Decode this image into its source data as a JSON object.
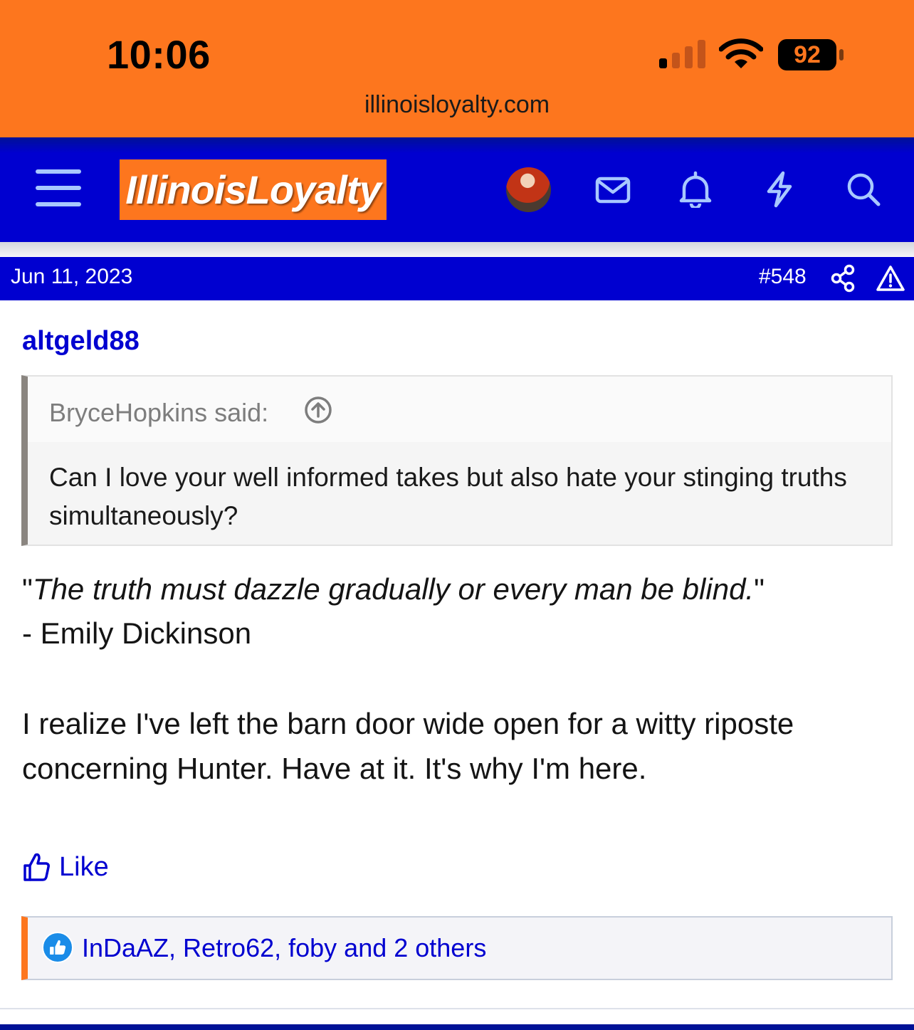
{
  "status_bar": {
    "time": "10:06",
    "battery": "92",
    "url": "illinoisloyalty.com"
  },
  "header": {
    "logo": "IllinoisLoyalty",
    "icons": [
      "menu-icon",
      "avatar",
      "mail-icon",
      "bell-icon",
      "bolt-icon",
      "search-icon"
    ]
  },
  "post": {
    "date": "Jun 11, 2023",
    "number": "#548",
    "author": "altgeld88",
    "quote": {
      "author_line": "BryceHopkins said:",
      "text": "Can I love your well informed takes but also hate your stinging truths simultaneously?"
    },
    "epigraph": {
      "open": "\"",
      "text": "The truth must dazzle gradually or every man be blind.",
      "close": "\"",
      "attribution": "- Emily Dickinson"
    },
    "body": "I realize I've left the barn door wide open for a witty riposte concerning Hunter. Have at it. It's why I'm here.",
    "like_label": "Like",
    "reactions_text": "InDaAZ, Retro62, foby and 2 others"
  },
  "colors": {
    "orange": "#fd761e",
    "blue": "#0000d0",
    "navy": "#001196"
  }
}
